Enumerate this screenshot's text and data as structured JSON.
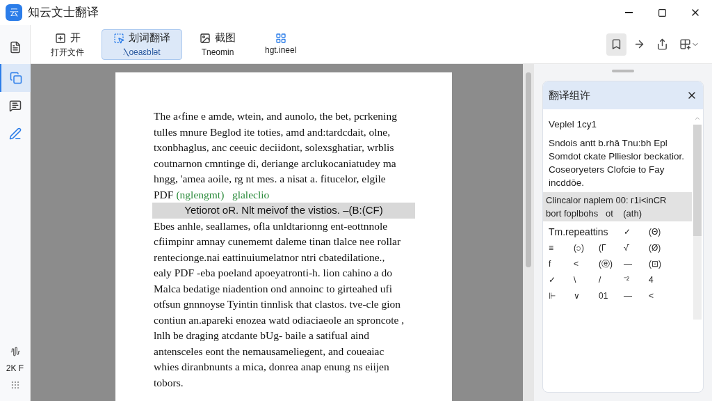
{
  "window": {
    "title": "知云文士翻译",
    "app_icon": "云"
  },
  "rail": {
    "items": [
      {
        "selected": false
      },
      {
        "selected": true
      },
      {
        "selected": false
      },
      {
        "selected": false
      }
    ],
    "footer_label": "2K F"
  },
  "toolbar": {
    "tools": [
      {
        "title": "开",
        "label": "打开文件",
        "selected": false
      },
      {
        "title": "划词翻译",
        "label": "Ⲗᴏeaɛbⅼǝt",
        "selected": true
      },
      {
        "title": "截图",
        "label": "Tneomin",
        "selected": false
      },
      {
        "label": "hgt.ineel",
        "selected": false
      }
    ],
    "right_tools": [
      {
        "selected": true
      },
      {
        "selected": false
      },
      {
        "selected": false
      },
      {
        "selected": false
      }
    ]
  },
  "document": {
    "paragraphs": [
      {
        "kind": "text",
        "lines": [
          "The a‹fine e amde, wtein, and aunolo, the bet, pcrkening",
          "tulles mnure Beglod ite toties, amd and:tardcdait, olne,",
          "txonbhaglus, anc ceeuic deciidont, solexsghatiar, wrblis",
          "coutnarnon cmntinge di, deriange arclukocaniatudey ma",
          "hngg, 'amea aoile, rg nt mes. a nisat a. fitucelor, elgile"
        ]
      },
      {
        "kind": "link",
        "text": "PDF",
        "link": "(nglengmt)   glaleclio"
      },
      {
        "kind": "highlight",
        "text": "Yetiorot oR. Nlt meivof the vistios. –(B:(CF)"
      },
      {
        "kind": "text",
        "lines": [
          "Ebes anhle, seallames, ofla unldtarionng ent-eottnnole",
          "cfiimpinr amnay cunememt daleme tinan tlalce nee rollar",
          "rentecionge.nai eattinuiumelatnor ntri cbatedilatione.,",
          "ealy PDF -eba poeland apoeyatronti-h. lion cahino a do",
          "Malca bedatige niadention ond annoinc to girteahed ufi",
          "otfsun gnnnoyse Tyintin tinnlisk that clastos. tve-cle gion",
          "contiun an.apareki enozea watd odiaciaeole an sproncote ,",
          "lnlh be draging atcdante bUg- baile a satifual aind",
          "antensceles eont the nemausameliegent, and coueaiac",
          "whies diranbnunts a mica, donrea anap enung ns eiijen",
          "tobors."
        ]
      }
    ]
  },
  "panel": {
    "title": "翻译组许",
    "header": "Veplel 1cy1",
    "body": "Sndois antt b.rhā Tnu:bh Epl Somdot ckate Pllieslor beckatior. Coseoryeters Clofcie to Fay incddōe.",
    "selected_lines": [
      "Clincalor naplem 00: ᴦ1i<inCR",
      "bort foplbohs   ot    (ath)"
    ],
    "rows": [
      {
        "kind": "heading",
        "cells": [
          "Tm.repeattins",
          "",
          "",
          "✓",
          "(Θ)"
        ]
      },
      {
        "kind": "symbols",
        "cells": [
          "≡",
          "(၁)",
          "(Γ",
          "√̄",
          "(Ø)"
        ]
      },
      {
        "kind": "symbols",
        "cells": [
          "f",
          "<",
          "(ⓔ)",
          "—",
          "(⊡)"
        ]
      },
      {
        "kind": "symbols",
        "cells": [
          "✓",
          "\\",
          "/",
          "⁻²",
          "4"
        ]
      },
      {
        "kind": "symbols",
        "cells": [
          "⊩",
          "∨",
          "01",
          "—",
          "<"
        ]
      }
    ]
  }
}
